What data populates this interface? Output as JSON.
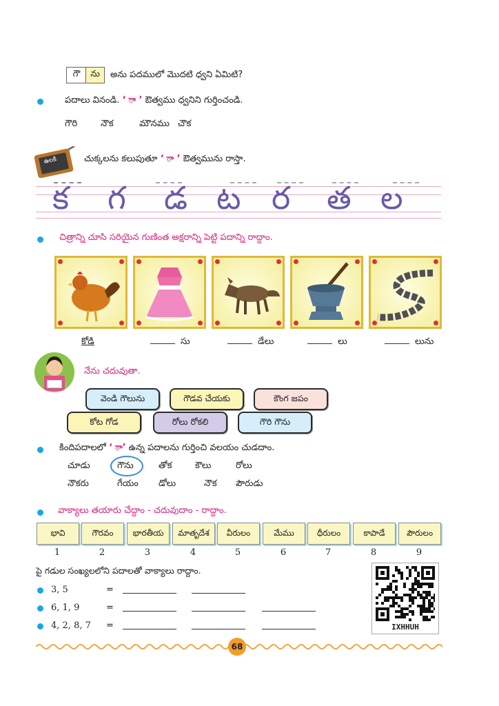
{
  "header_question": {
    "boxes": [
      "గౌ",
      "ను"
    ],
    "text": "అను పదములో మొదటి ధ్వని ఏమిటి?"
  },
  "listen": {
    "text_before": "పదాలు వినండి.",
    "quote_symbol": "‘ ా ’",
    "text_after": "ఔత్వము ధ్వనిని గుర్తించండి.",
    "words": [
      "గౌరి",
      "నౌక",
      "మౌనము",
      "చౌక"
    ]
  },
  "slate": {
    "label": "ఉలకి",
    "text_before": "చుక్కలను కలుపుతూ",
    "quote_symbol": "‘ ా ’",
    "text_after": "ఔత్వమును రాస్తా."
  },
  "tracing": {
    "letters": [
      "క",
      "గ",
      "డ",
      "ట",
      "ర",
      "త",
      "ల"
    ]
  },
  "pictures_section": {
    "title": "చిత్రాన్ని చూసి సరియైన గుణింత అక్షరాన్ని పెట్టి పదాన్ని రాద్దాం.",
    "icons": [
      "hen-image",
      "frock-image",
      "fox-image",
      "mortar-image",
      "chain-image"
    ],
    "answers": [
      "కోడి",
      "సు",
      "డేలు",
      "లు",
      "లును"
    ]
  },
  "reading": {
    "title": "నేను చదువుతా.",
    "row1": [
      "వెండి గౌలును",
      "గౌడవ చేయకు",
      "కౌంగ జపం"
    ],
    "row2": [
      "కోట గోడ",
      "రోలు రోకలి",
      "గౌరి గౌను"
    ]
  },
  "identify": {
    "text_before": "కిందిపదాలలో",
    "quote_symbol": "‘ ా’",
    "text_after": "ఉన్న పదాలను గుర్తించి వలయం చుడదాం.",
    "row1": [
      "చూడు",
      "గౌను",
      "తోక",
      "కౌలు",
      "రోలు"
    ],
    "row2": [
      "నౌకరు",
      "గేయం",
      "డోలు",
      "నౌక",
      "పౌరుడు"
    ]
  },
  "sentences": {
    "title": "వాక్యాలు తయారు చేద్దాం - చదువుదాం - రాద్దాం.",
    "words": [
      "భావి",
      "గౌరవం",
      "భారతీయ",
      "మాతృదేశ",
      "వీరులం",
      "మేము",
      "ధీరులం",
      "కాపాడే",
      "పౌరులం"
    ],
    "numbers": [
      "1",
      "2",
      "3",
      "4",
      "5",
      "6",
      "7",
      "8",
      "9"
    ],
    "instruction": "పై గడుల సంఖ్యలలోని పదాలతో వాక్యాలు రాద్దాం.",
    "rows": [
      {
        "label": "3, 5",
        "eq": "="
      },
      {
        "label": "6, 1, 9",
        "eq": "="
      },
      {
        "label": "4, 2, 8, 7",
        "eq": "="
      }
    ]
  },
  "qr": {
    "code": "IXHHUH"
  },
  "page_number": "68",
  "colors": {
    "accent_pink": "#d4267e",
    "bullet_blue": "#1aa7e0",
    "page_badge": "#f39c2a"
  }
}
